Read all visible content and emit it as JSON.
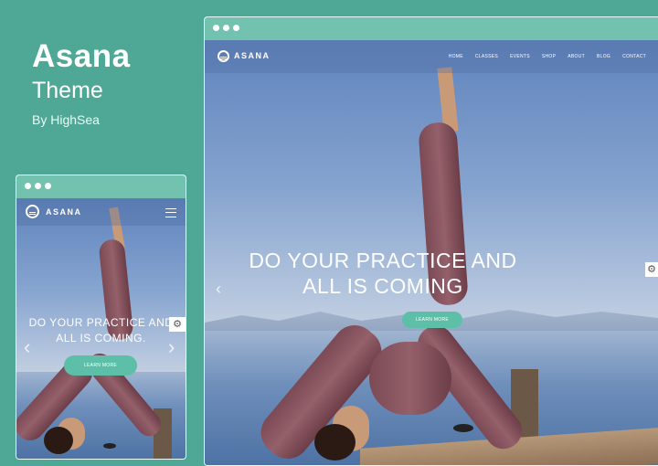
{
  "promo": {
    "title": "Asana",
    "subtitle": "Theme",
    "byline": "By HighSea"
  },
  "desktop": {
    "logo": "ASANA",
    "nav": [
      "HOME",
      "CLASSES",
      "EVENTS",
      "SHOP",
      "ABOUT",
      "BLOG",
      "CONTACT"
    ],
    "hero_line1": "DO YOUR PRACTICE AND",
    "hero_line2": "ALL IS COMING",
    "cta": "LEARN MORE"
  },
  "mobile": {
    "logo": "ASANA",
    "hero_line1": "DO YOUR PRACTICE AND",
    "hero_line2": "ALL IS COMING.",
    "cta": "LEARN MORE"
  },
  "icons": {
    "browser_dots": "window-dots-icon",
    "logo": "asana-logo-icon",
    "menu": "hamburger-menu-icon",
    "settings": "gear-icon",
    "prev": "chevron-left-icon",
    "next": "chevron-right-icon"
  },
  "colors": {
    "background": "#4fa896",
    "accent": "#5dbfa8",
    "browser_bar": "#73c2b0"
  }
}
